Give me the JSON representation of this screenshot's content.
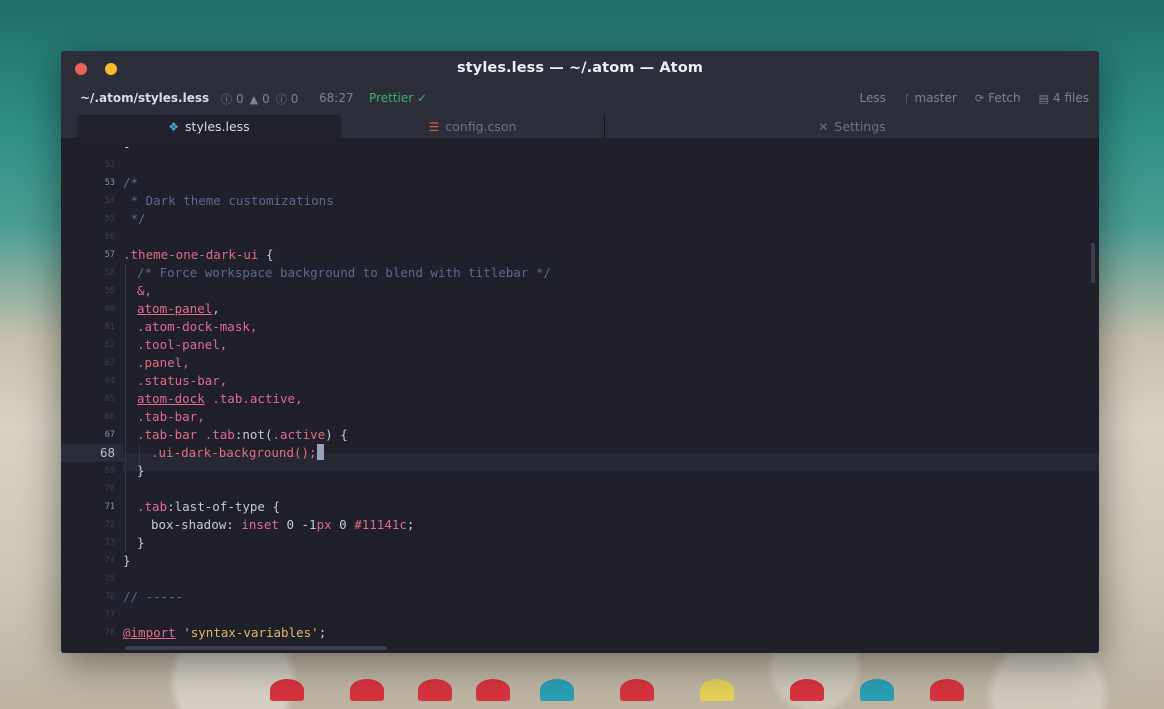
{
  "window": {
    "title": "styles.less — ~/.atom — Atom"
  },
  "status": {
    "path": "~/.atom/styles.less",
    "errors": "0",
    "warnings": "0",
    "infos": "0",
    "cursor": "68:27",
    "prettier": "Prettier ✓",
    "grammar": "Less",
    "branch": "master",
    "fetch": "Fetch",
    "files": "4 files"
  },
  "tabs": [
    {
      "label": "styles.less",
      "icon": "css-icon",
      "active": true
    },
    {
      "label": "config.cson",
      "icon": "database-icon",
      "active": false
    },
    {
      "label": "Settings",
      "icon": "tools-icon",
      "active": false
    }
  ],
  "editor": {
    "current_line": "68",
    "line_numbers": [
      "52",
      "53",
      "54",
      "55",
      "56",
      "57",
      "58",
      "59",
      "60",
      "61",
      "62",
      "63",
      "64",
      "65",
      "66",
      "67",
      "68",
      "69",
      "70",
      "71",
      "72",
      "73",
      "74",
      "75",
      "76",
      "77",
      "78"
    ],
    "code": {
      "l52": "-",
      "l53": "/*",
      "l54": " * Dark theme customizations",
      "l55": " */",
      "l57_sel": ".theme-one-dark-ui",
      "l57_brace": " {",
      "l58": "/* Force workspace background to blend with titlebar */",
      "l59": "&,",
      "l60_tag": "atom-panel",
      "l61": ".atom-dock-mask,",
      "l62": ".tool-panel,",
      "l63": ".panel,",
      "l64": ".status-bar,",
      "l65_tag": "atom-dock",
      "l65_rest": " .tab.active,",
      "l66": ".tab-bar,",
      "l67_a": ".tab-bar .tab",
      "l67_b": ":not(",
      "l67_c": ".active",
      "l67_d": ") {",
      "l68": ".ui-dark-background();",
      "l69": "}",
      "l71_a": ".tab",
      "l71_b": ":last-of-type {",
      "l72_prop": "box-shadow: ",
      "l72_val1": "inset ",
      "l72_val2": "0 -1",
      "l72_val3": "px ",
      "l72_val4": "0 ",
      "l72_val5": "#11141c",
      "l72_end": ";",
      "l73": "}",
      "l74": "}",
      "l76": "// -----",
      "l78_at": "@import",
      "l78_str": " 'syntax-variables'",
      "l78_end": ";"
    }
  }
}
